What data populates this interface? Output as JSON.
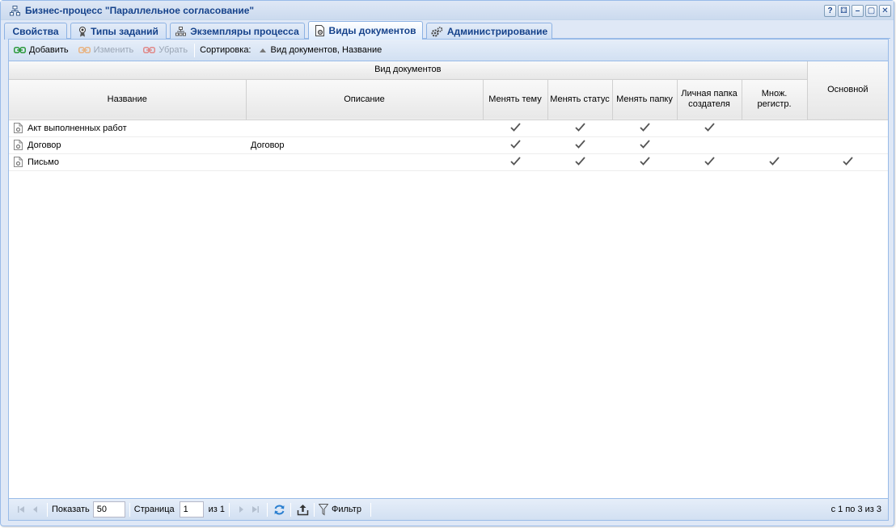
{
  "window": {
    "title": "Бизнес-процесс \"Параллельное согласование\"",
    "tool_icons": [
      "help-icon",
      "print-icon",
      "minimize-icon",
      "maximize-icon",
      "close-icon"
    ],
    "tool_glyphs": [
      "?",
      "⚃",
      "–",
      "▢",
      "✕"
    ]
  },
  "tabs": [
    {
      "label": "Свойства",
      "icon": "",
      "active": false
    },
    {
      "label": "Типы заданий",
      "icon": "ribbon-icon",
      "active": false
    },
    {
      "label": "Экземпляры процесса",
      "icon": "hierarchy-icon",
      "active": false
    },
    {
      "label": "Виды документов",
      "icon": "document-gear-icon",
      "active": true
    },
    {
      "label": "Администрирование",
      "icon": "gears-icon",
      "active": false
    }
  ],
  "toolbar": {
    "add_label": "Добавить",
    "edit_label": "Изменить",
    "remove_label": "Убрать",
    "sort_label": "Сортировка:",
    "sort_value": "Вид документов, Название"
  },
  "grid": {
    "group_header": "Вид документов",
    "columns": {
      "name": "Название",
      "description": "Описание",
      "change_subject": "Менять тему",
      "change_status": "Менять статус",
      "change_folder": "Менять папку",
      "personal_folder": "Личная папка создателя",
      "multi_reg": "Множ. регистр.",
      "main": "Основной"
    },
    "rows": [
      {
        "name": "Акт выполненных работ",
        "description": "",
        "checks": [
          true,
          true,
          true,
          true,
          false,
          false
        ]
      },
      {
        "name": "Договор",
        "description": "Договор",
        "checks": [
          true,
          true,
          true,
          false,
          false,
          false
        ]
      },
      {
        "name": "Письмо",
        "description": "",
        "checks": [
          true,
          true,
          true,
          true,
          true,
          true
        ]
      }
    ]
  },
  "pager": {
    "show_label": "Показать",
    "page_size": "50",
    "page_label": "Страница",
    "page_value": "1",
    "of_label": "из 1",
    "filter_label": "Фильтр",
    "info": "с 1 по 3 из 3"
  }
}
